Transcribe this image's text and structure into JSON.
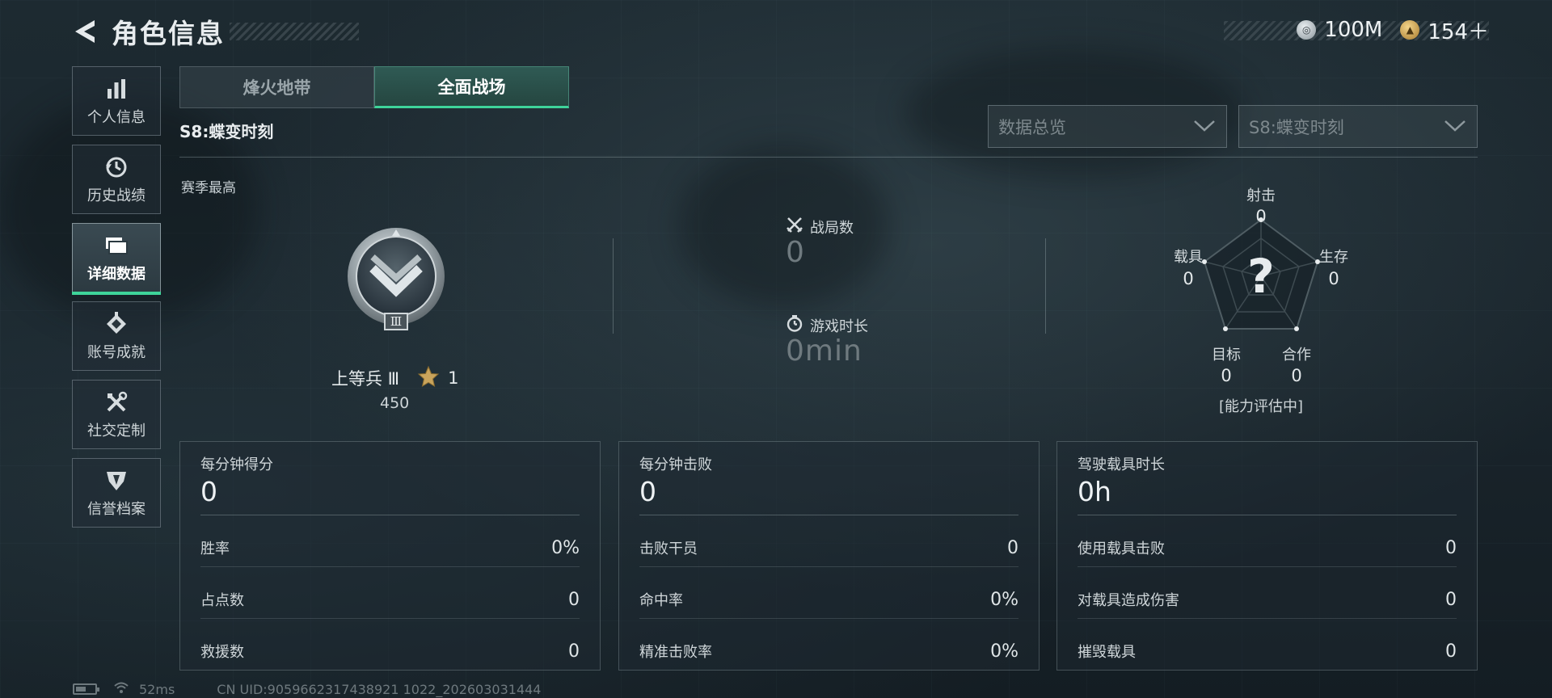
{
  "header": {
    "title": "角色信息",
    "currencies": [
      {
        "icon": "silver-coin-icon",
        "value": "100M"
      },
      {
        "icon": "gold-coin-icon",
        "value": "154＋"
      }
    ]
  },
  "nav": {
    "items": [
      {
        "icon": "bar-chart-icon",
        "label": "个人信息",
        "active": false
      },
      {
        "icon": "history-clock-icon",
        "label": "历史战绩",
        "active": false
      },
      {
        "icon": "folder-icon",
        "label": "详细数据",
        "active": true
      },
      {
        "icon": "medal-icon",
        "label": "账号成就",
        "active": false
      },
      {
        "icon": "tools-icon",
        "label": "社交定制",
        "active": false
      },
      {
        "icon": "shield-emblem-icon",
        "label": "信誉档案",
        "active": false
      }
    ]
  },
  "tabs": [
    {
      "label": "烽火地带",
      "active": false
    },
    {
      "label": "全面战场",
      "active": true
    }
  ],
  "season_title": "S8:蝶变时刻",
  "filters": {
    "view": "数据总览",
    "season": "S8:蝶变时刻"
  },
  "rank": {
    "section_label": "赛季最高",
    "name": "上等兵 Ⅲ",
    "stars": "1",
    "points": "450",
    "badge_numeral": "Ⅲ"
  },
  "summary": {
    "matches_label": "战局数",
    "matches_value": "0",
    "playtime_label": "游戏时长",
    "playtime_value": "0min"
  },
  "radar": {
    "center_mark": "?",
    "note": "[能力评估中]",
    "axes": [
      {
        "label": "射击",
        "value": "0"
      },
      {
        "label": "生存",
        "value": "0"
      },
      {
        "label": "合作",
        "value": "0"
      },
      {
        "label": "目标",
        "value": "0"
      },
      {
        "label": "载具",
        "value": "0"
      }
    ]
  },
  "panels": [
    {
      "title": "每分钟得分",
      "big": "0",
      "rows": [
        {
          "k": "胜率",
          "v": "0%"
        },
        {
          "k": "占点数",
          "v": "0"
        },
        {
          "k": "救援数",
          "v": "0"
        }
      ]
    },
    {
      "title": "每分钟击败",
      "big": "0",
      "rows": [
        {
          "k": "击败干员",
          "v": "0"
        },
        {
          "k": "命中率",
          "v": "0%"
        },
        {
          "k": "精准击败率",
          "v": "0%"
        }
      ]
    },
    {
      "title": "驾驶载具时长",
      "big": "0h",
      "rows": [
        {
          "k": "使用载具击败",
          "v": "0"
        },
        {
          "k": "对载具造成伤害",
          "v": "0"
        },
        {
          "k": "摧毁载具",
          "v": "0"
        }
      ]
    }
  ],
  "footer": {
    "ping": "52ms",
    "uid": "CN UID:9059662317438921 1022_202603031444"
  }
}
